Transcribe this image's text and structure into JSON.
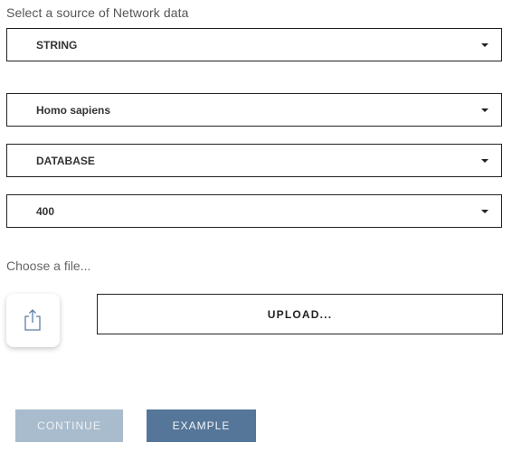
{
  "form": {
    "heading": "Select a source of Network data",
    "selects": {
      "source": "STRING",
      "organism": "Homo sapiens",
      "type": "DATABASE",
      "threshold": "400"
    },
    "file_label": "Choose a file...",
    "upload_label": "UPLOAD...",
    "upload_icon": "share-upload-icon"
  },
  "actions": {
    "continue_label": "CONTINUE",
    "example_label": "EXAMPLE"
  },
  "colors": {
    "continue_bg": "#a9bccd",
    "example_bg": "#557699",
    "icon_stroke": "#5b7fa6"
  }
}
